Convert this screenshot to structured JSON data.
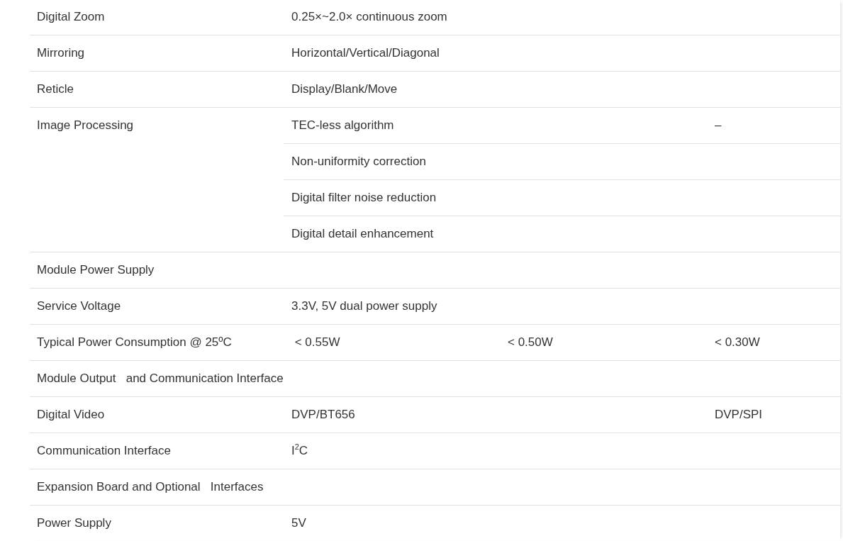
{
  "rows": [
    {
      "label": "Digital Zoom",
      "lines": [
        {
          "column_1": "0.25×~2.0× continuous zoom"
        }
      ]
    },
    {
      "label": "Mirroring",
      "lines": [
        {
          "column_1": "Horizontal/Vertical/Diagonal"
        }
      ]
    },
    {
      "label": "Reticle",
      "lines": [
        {
          "column_1": "Display/Blank/Move"
        }
      ]
    },
    {
      "label": "Image Processing",
      "lines": [
        {
          "column_1": "TEC-less algorithm",
          "column_3": "–"
        },
        {
          "column_1": "Non-uniformity correction"
        },
        {
          "column_1": "Digital filter noise reduction"
        },
        {
          "column_1": "Digital detail enhancement"
        }
      ]
    },
    {
      "label": "Module Power Supply"
    },
    {
      "label": "Service Voltage",
      "lines": [
        {
          "column_1": "3.3V, 5V dual power supply"
        }
      ]
    },
    {
      "label": "Typical Power Consumption @ 25ºC",
      "lines": [
        {
          "column_1": " < 0.55W",
          "column_2": "< 0.50W",
          "column_3": "< 0.30W"
        }
      ]
    },
    {
      "label": "Module Output   and Communication Interface"
    },
    {
      "label": "Digital Video",
      "lines": [
        {
          "column_1": "DVP/BT656",
          "column_3": "DVP/SPI"
        }
      ]
    },
    {
      "label": "Communication Interface",
      "lines": [
        {
          "column_1": "I$^{2}$C"
        }
      ]
    },
    {
      "label": "Expansion Board and Optional   Interfaces"
    },
    {
      "label": "Power Supply",
      "lines": [
        {
          "column_1": "5V"
        }
      ]
    }
  ]
}
